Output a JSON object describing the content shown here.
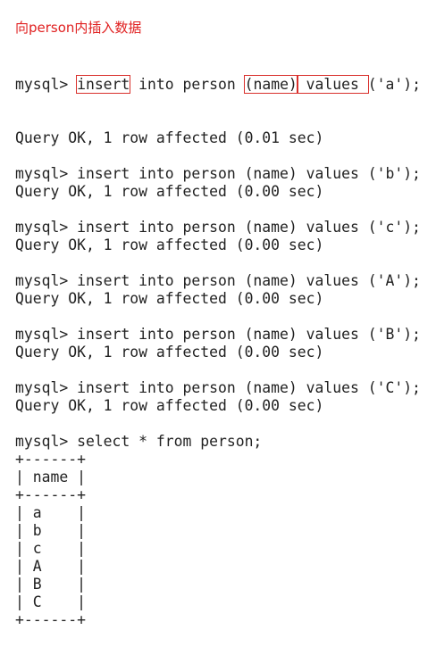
{
  "annotation": {
    "text": "向person内插入数据",
    "color": "#e02020"
  },
  "highlight_color": "#d9302c",
  "first_command": {
    "prompt": "mysql> ",
    "kw_insert": "insert",
    "kw_into": " into person ",
    "kw_name": "(name)",
    "kw_values": " values ",
    "tail": "('a');"
  },
  "lines": [
    "Query OK, 1 row affected (0.01 sec)",
    "",
    "mysql> insert into person (name) values ('b');",
    "Query OK, 1 row affected (0.00 sec)",
    "",
    "mysql> insert into person (name) values ('c');",
    "Query OK, 1 row affected (0.00 sec)",
    "",
    "mysql> insert into person (name) values ('A');",
    "Query OK, 1 row affected (0.00 sec)",
    "",
    "mysql> insert into person (name) values ('B');",
    "Query OK, 1 row affected (0.00 sec)",
    "",
    "mysql> insert into person (name) values ('C');",
    "Query OK, 1 row affected (0.00 sec)",
    "",
    "mysql> select * from person;",
    "+------+",
    "| name |",
    "+------+",
    "| a    |",
    "| b    |",
    "| c    |",
    "| A    |",
    "| B    |",
    "| C    |",
    "+------+"
  ]
}
